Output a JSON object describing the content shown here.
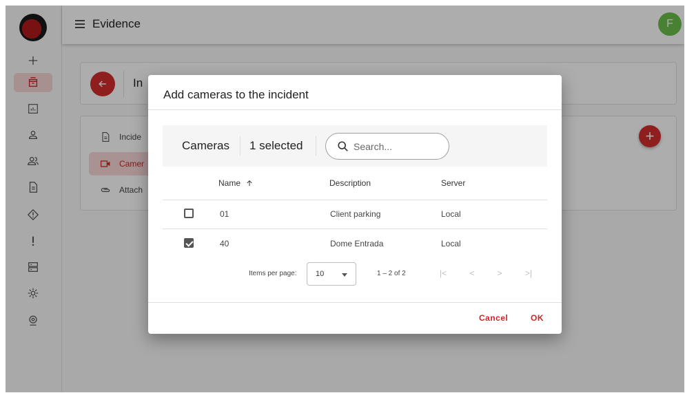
{
  "app": {
    "title": "Evidence",
    "avatar_initial": "F",
    "accent": "#d32f2f",
    "avatar_color": "#6abf4b"
  },
  "sidebar": {
    "items": [
      {
        "icon": "plus-icon",
        "active": false
      },
      {
        "icon": "incident-box-icon",
        "active": true
      },
      {
        "icon": "chart-icon",
        "active": false
      },
      {
        "icon": "person-icon",
        "active": false
      },
      {
        "icon": "people-icon",
        "active": false
      },
      {
        "icon": "document-icon",
        "active": false
      },
      {
        "icon": "diamond-alert-icon",
        "active": false
      },
      {
        "icon": "exclamation-icon",
        "active": false
      },
      {
        "icon": "server-icon",
        "active": false
      },
      {
        "icon": "gear-icon",
        "active": false
      },
      {
        "icon": "badge-icon",
        "active": false
      }
    ]
  },
  "incident": {
    "title_partial": "In",
    "tabs": [
      {
        "label": "Incide",
        "icon": "document-icon",
        "active": false
      },
      {
        "label": "Camer",
        "icon": "camera-icon",
        "active": true
      },
      {
        "label": "Attach",
        "icon": "paperclip-icon",
        "active": false
      }
    ]
  },
  "dialog": {
    "title": "Add cameras to the incident",
    "toolbar": {
      "label": "Cameras",
      "selected": "1 selected",
      "search_placeholder": "Search..."
    },
    "columns": {
      "name": "Name",
      "sort_icon": "arrow-up-icon",
      "description": "Description",
      "server": "Server"
    },
    "rows": [
      {
        "name": "01",
        "description": "Client parking",
        "server": "Local",
        "checked": false
      },
      {
        "name": "40",
        "description": "Dome Entrada",
        "server": "Local",
        "checked": true
      }
    ],
    "pager": {
      "items_per_page_label": "Items per page:",
      "items_per_page": "10",
      "range": "1 – 2 of 2",
      "first": "|<",
      "prev": "<",
      "next": ">",
      "last": ">|"
    },
    "cancel": "Cancel",
    "ok": "OK"
  }
}
